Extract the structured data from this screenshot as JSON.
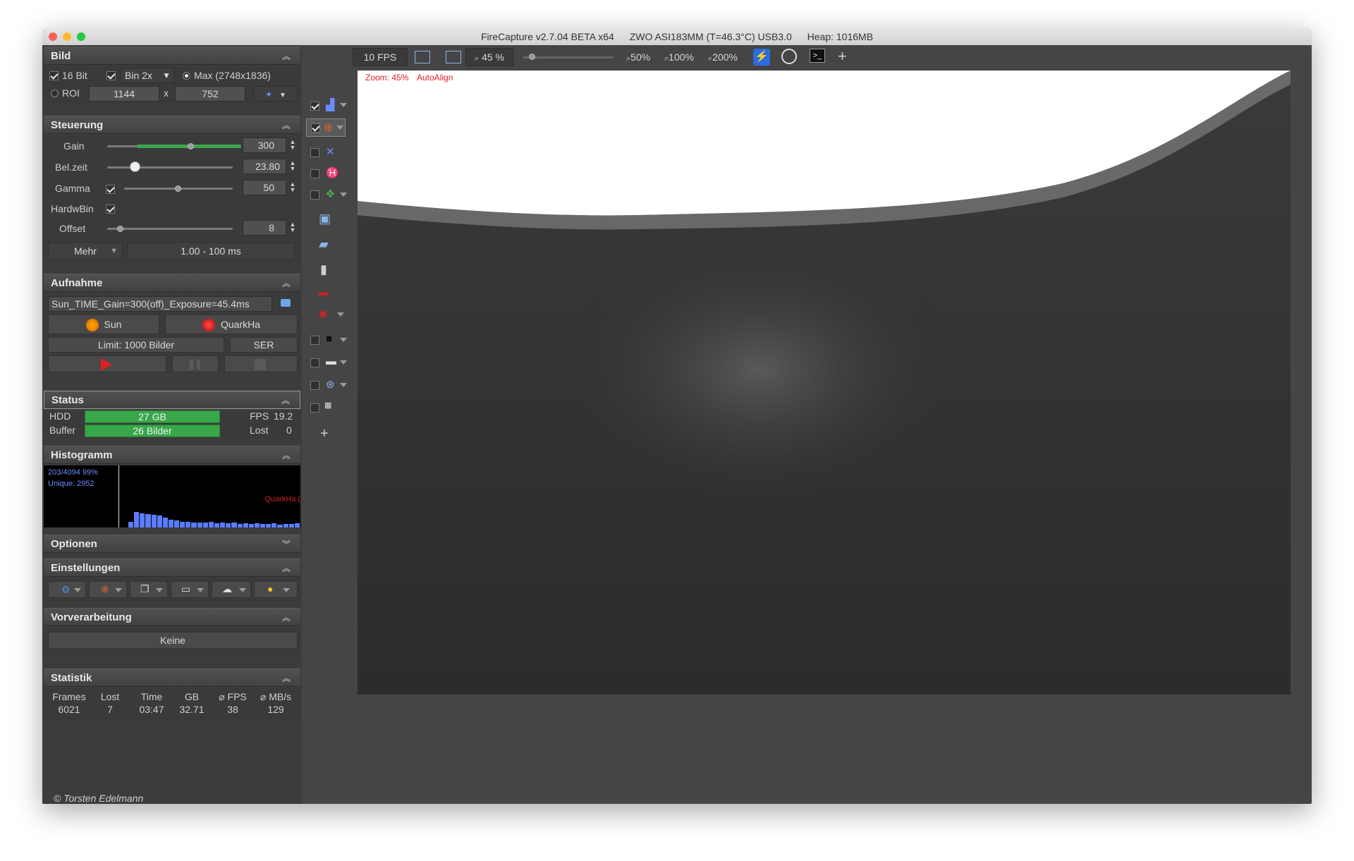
{
  "window": {
    "title_app": "FireCapture v2.7.04 BETA x64",
    "title_camera": "ZWO ASI183MM (T=46.3°C) USB3.0",
    "title_heap": "Heap: 1016MB"
  },
  "bild": {
    "title": "Bild",
    "bit16_label": "16 Bit",
    "bin_value": "Bin 2x",
    "max_label": "Max (2748x1836)",
    "roi_label": "ROI",
    "roi_width": "1144",
    "roi_x": "x",
    "roi_height": "752"
  },
  "steuerung": {
    "title": "Steuerung",
    "gain_label": "Gain",
    "gain_value": "300",
    "gain_fraction": 0.62,
    "belzeit_label": "Bel.zeit",
    "belzeit_value": "23.80",
    "belzeit_fraction": 0.22,
    "gamma_label": "Gamma",
    "gamma_value": "50",
    "gamma_fraction": 0.5,
    "hardwbin_label": "HardwBin",
    "offset_label": "Offset",
    "offset_value": "8",
    "offset_fraction": 0.08,
    "mehr_label": "Mehr",
    "range_label": "1.00 - 100 ms"
  },
  "aufnahme": {
    "title": "Aufnahme",
    "filename": "Sun_TIME_Gain=300(off)_Exposure=45.4ms",
    "profile_sun": "Sun",
    "profile_quarkha": "QuarkHa",
    "limit_label": "Limit: 1000 Bilder",
    "format_label": "SER"
  },
  "status": {
    "title": "Status",
    "hdd_label": "HDD",
    "hdd_value": "27 GB",
    "buffer_label": "Buffer",
    "buffer_value": "26  Bilder",
    "fps_label": "FPS",
    "fps_value": "19.2",
    "lost_label": "Lost",
    "lost_value": "0"
  },
  "histogramm": {
    "title": "Histogramm",
    "stat1": "203/4094 99%",
    "stat2": "Unique: 2952",
    "profile_tag": "QuarkHa (",
    "bar_levels": [
      0.35,
      0.9,
      0.85,
      0.8,
      0.75,
      0.7,
      0.6,
      0.45,
      0.4,
      0.35,
      0.35,
      0.3,
      0.3,
      0.28,
      0.32,
      0.25,
      0.3,
      0.25,
      0.28,
      0.22,
      0.26,
      0.2,
      0.24,
      0.22,
      0.2,
      0.24,
      0.18,
      0.22,
      0.2,
      0.25
    ]
  },
  "optionen": {
    "title": "Optionen"
  },
  "einstellungen": {
    "title": "Einstellungen"
  },
  "vorverarbeitung": {
    "title": "Vorverarbeitung",
    "value": "Keine"
  },
  "statistik": {
    "title": "Statistik",
    "headers": [
      "Frames",
      "Lost",
      "Time",
      "GB",
      "⌀ FPS",
      "⌀ MB/s"
    ],
    "values": [
      "6021",
      "7",
      "03:47",
      "32.71",
      "38",
      "129"
    ]
  },
  "footer": {
    "copyright": "© Torsten Edelmann"
  },
  "toolbar": {
    "fps_button": "10 FPS",
    "zoom_value": "45 %",
    "zoom_fraction": 0.08,
    "zoom50": "50%",
    "zoom100": "100%",
    "zoom200": "200%"
  },
  "viewer": {
    "zoom_text": "Zoom: 45%",
    "autoalign_text": "AutoAlign"
  },
  "colors": {
    "accent_green": "#38a74a",
    "record_red": "#e02020",
    "hist_blue": "#5c7cff"
  }
}
